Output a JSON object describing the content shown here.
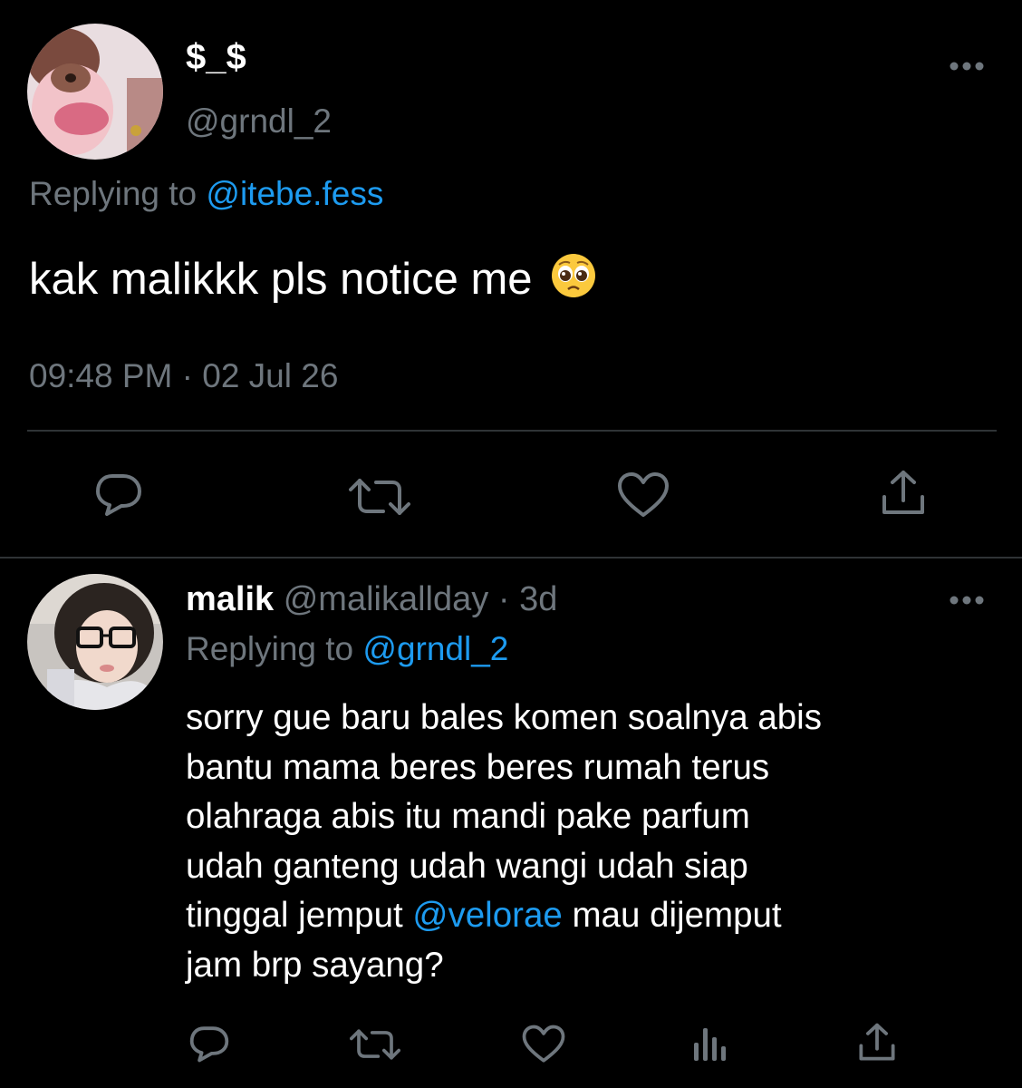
{
  "main_tweet": {
    "display_name": "$_$",
    "handle": "@grndl_2",
    "replying_prefix": "Replying to",
    "replying_handle": "@itebe.fess",
    "text": "kak malikkk pls notice me",
    "emoji": "pleading-face-icon",
    "timestamp": "09:48 PM · 02 Jul 26",
    "actions": [
      "reply-icon",
      "retweet-icon",
      "like-icon",
      "share-icon"
    ]
  },
  "reply_tweet": {
    "display_name": "malik",
    "handle": "@malikallday",
    "separator": "·",
    "time_ago": "3d",
    "replying_prefix": "Replying to",
    "replying_handle": "@grndl_2",
    "lines": {
      "l1": "sorry gue baru bales komen soalnya abis",
      "l2": "bantu mama beres beres rumah terus",
      "l3": "olahraga abis itu mandi pake parfum",
      "l4": "udah ganteng udah wangi udah siap",
      "l5_before": "tinggal jemput",
      "l5_mention": "@velorae",
      "l5_after": "mau dijemput",
      "l6": "jam brp sayang?"
    },
    "actions": [
      "reply-icon",
      "retweet-icon",
      "like-icon",
      "analytics-icon",
      "share-icon"
    ]
  },
  "colors": {
    "background": "#000000",
    "text": "#ffffff",
    "muted": "#6e767d",
    "link": "#1d9bf0",
    "divider": "#2f3336"
  }
}
